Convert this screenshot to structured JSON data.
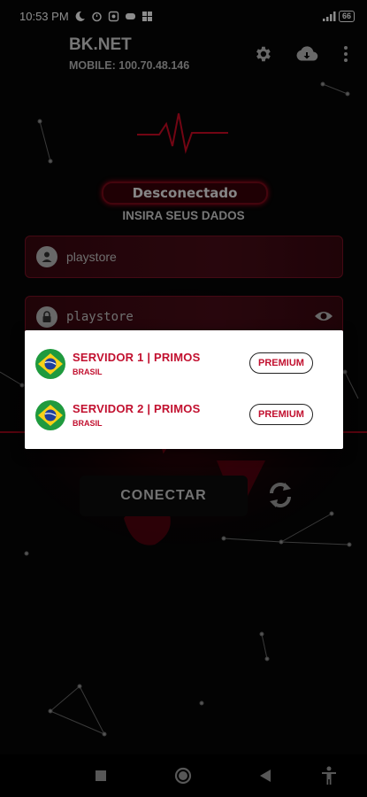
{
  "status_bar": {
    "time": "10:53 PM",
    "battery": "66"
  },
  "app": {
    "title": "BK.NET",
    "subtitle": "MOBILE: 100.70.48.146"
  },
  "toolbar": {
    "settings_icon": "gear-icon",
    "download_icon": "cloud-download-icon",
    "menu_icon": "more-vert-icon"
  },
  "connection": {
    "status": "Desconectado",
    "instruction": "INSIRA SEUS DADOS"
  },
  "login": {
    "username": "playstore",
    "password": "playstore"
  },
  "actions": {
    "connect": "CONECTAR"
  },
  "server_dialog": {
    "servers": [
      {
        "name": "SERVIDOR 1 | PRIMOS",
        "country": "BRASIL",
        "badge": "PREMIUM"
      },
      {
        "name": "SERVIDOR 2 | PRIMOS",
        "country": "BRASIL",
        "badge": "PREMIUM"
      }
    ]
  },
  "colors": {
    "accent": "#c2102f",
    "field_bg": "#4a0c18",
    "dialog_bg": "#ffffff"
  }
}
